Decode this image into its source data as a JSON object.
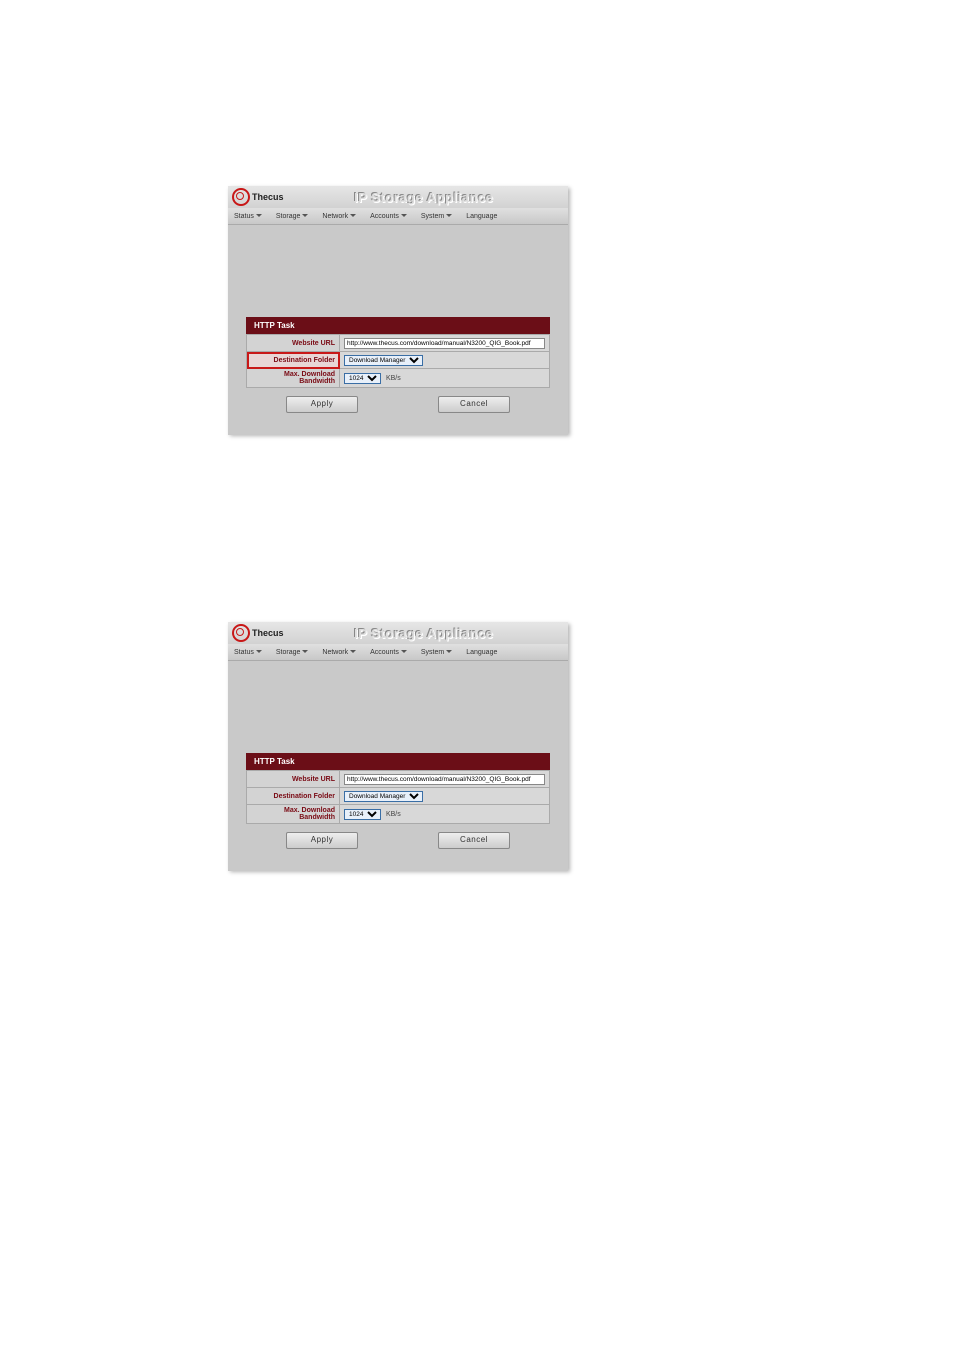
{
  "header": {
    "logo_text": "Thecus",
    "app_title": "IP Storage Appliance"
  },
  "menu": {
    "items": [
      "Status",
      "Storage",
      "Network",
      "Accounts",
      "System",
      "Language"
    ]
  },
  "panel": {
    "title": "HTTP Task",
    "rows": {
      "url_label": "Website URL",
      "url_value": "http://www.thecus.com/download/manual/N3200_QIG_Book.pdf",
      "folder_label": "Destination Folder",
      "folder_value": "Download Manager",
      "bw_label": "Max. Download Bandwidth",
      "bw_value": "1024",
      "bw_unit": "KB/s"
    },
    "buttons": {
      "apply": "Apply",
      "cancel": "Cancel"
    }
  },
  "screenshots": [
    {
      "highlight_folder_label": true
    },
    {
      "highlight_folder_label": false
    }
  ]
}
